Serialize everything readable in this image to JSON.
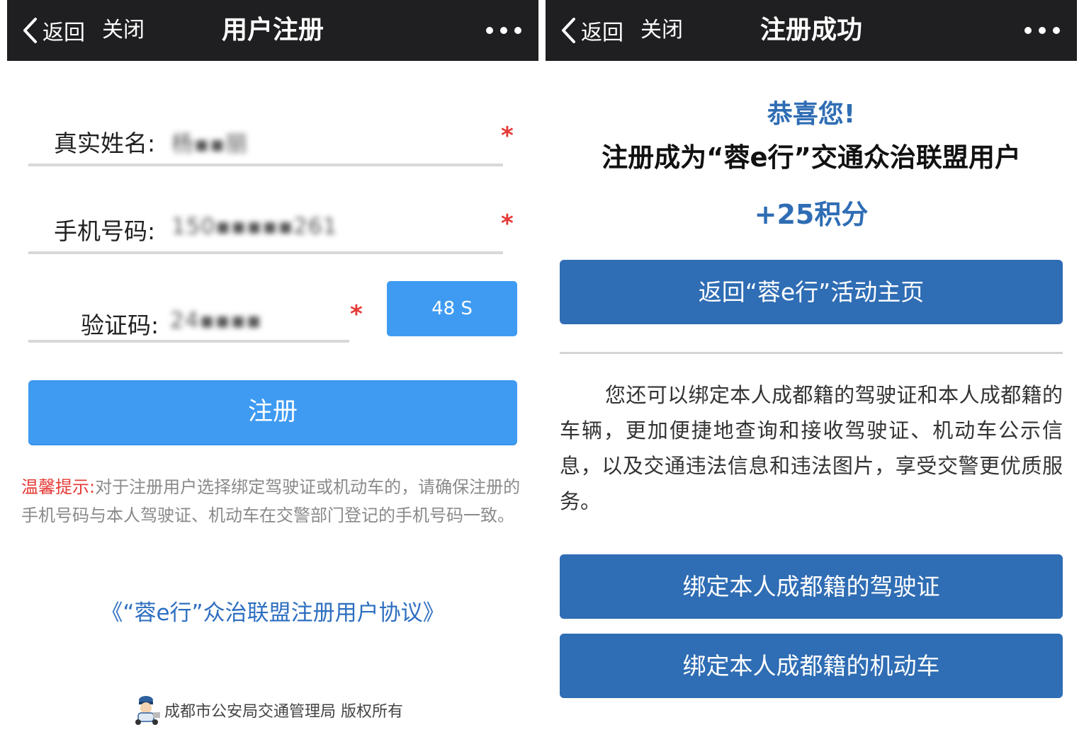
{
  "register": {
    "nav": {
      "back_label": "返回",
      "close_label": "关闭",
      "title": "用户注册"
    },
    "fields": {
      "name_label": "真实姓名:",
      "name_value": "杨▪▪丽",
      "phone_label": "手机号码:",
      "phone_value": "150▪▪▪▪▪261",
      "code_label": "验证码:",
      "code_value": "24▪▪▪▪",
      "required_mark": "*"
    },
    "countdown_button": "48 S",
    "submit_button": "注册",
    "tip_label": "温馨提示:",
    "tip_text": "对于注册用户选择绑定驾驶证或机动车的，请确保注册的手机号码与本人驾驶证、机动车在交警部门登记的手机号码一致。",
    "agreement_link": "《“蓉e行”众治联盟注册用户协议》",
    "footer_text": "成都市公安局交通管理局 版权所有"
  },
  "success": {
    "nav": {
      "back_label": "返回",
      "close_label": "关闭",
      "title": "注册成功"
    },
    "congrats": "恭喜您!",
    "registered_line": "注册成为“蓉e行”交通众治联盟用户",
    "points": "+25积分",
    "home_button": "返回“蓉e行”活动主页",
    "info_text": "您还可以绑定本人成都籍的驾驶证和本人成都籍的车辆，更加便捷地查询和接收驾驶证、机动车公示信息，以及交通违法信息和违法图片，享受交警更优质服务。",
    "bind_license_button": "绑定本人成都籍的驾驶证",
    "bind_vehicle_button": "绑定本人成都籍的机动车"
  },
  "colors": {
    "nav_bg": "#1f1f21",
    "primary_blue": "#3f9bf2",
    "dark_blue": "#2f6db4",
    "required_red": "#e53935"
  },
  "icons": [
    "chevron-left-icon",
    "more-dots-icon",
    "police-mascot-icon"
  ]
}
